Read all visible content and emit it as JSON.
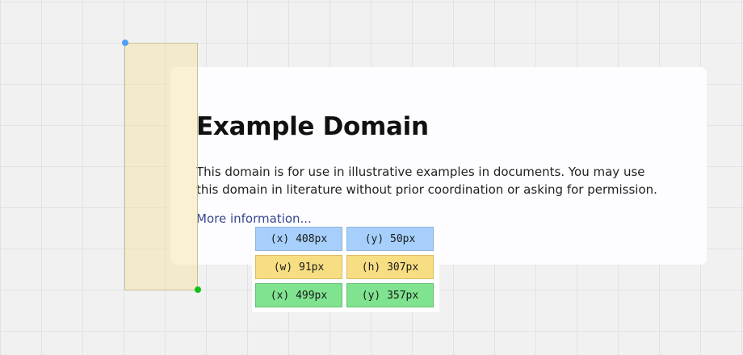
{
  "page": {
    "title": "Example Domain",
    "description": "This domain is for use in illustrative examples in documents. You may use this domain in literature without prior coordination or asking for permission.",
    "link_label": "More information..."
  },
  "measurement": {
    "start": {
      "x": "(x) 408px",
      "y": "(y) 50px"
    },
    "size": {
      "w": "(w) 91px",
      "h": "(h) 307px"
    },
    "end": {
      "x": "(x) 499px",
      "y": "(y) 357px"
    }
  },
  "colors": {
    "start_handle": "#4ea1f4",
    "end_handle": "#11c11a",
    "start_row": "#a6d0fb",
    "size_row": "#f8de83",
    "end_row": "#7fe38f",
    "link": "#38488f"
  }
}
